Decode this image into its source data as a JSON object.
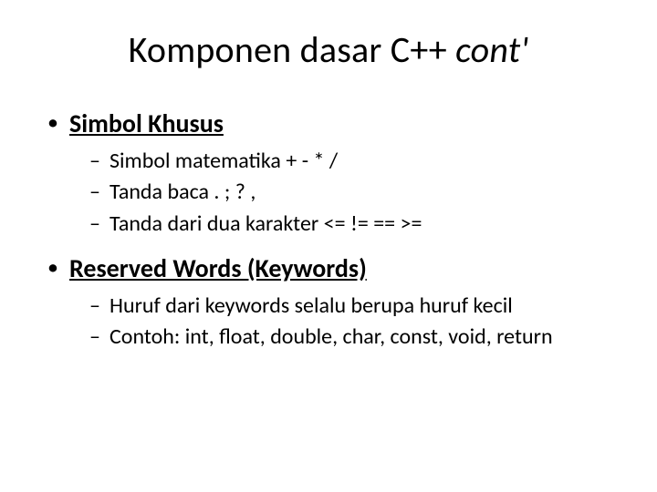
{
  "title_main": "Komponen dasar C++ ",
  "title_italic": "cont'",
  "items": [
    {
      "label": "Simbol Khusus",
      "sub": [
        "Simbol matematika   +   -   *   /",
        "Tanda baca   .   ;   ?   ,",
        "Tanda dari dua karakter   <=   !=   ==   >="
      ]
    },
    {
      "label": "Reserved Words (Keywords)",
      "sub": [
        "Huruf dari keywords selalu berupa huruf kecil",
        "Contoh: int, float, double, char, const, void, return"
      ]
    }
  ]
}
